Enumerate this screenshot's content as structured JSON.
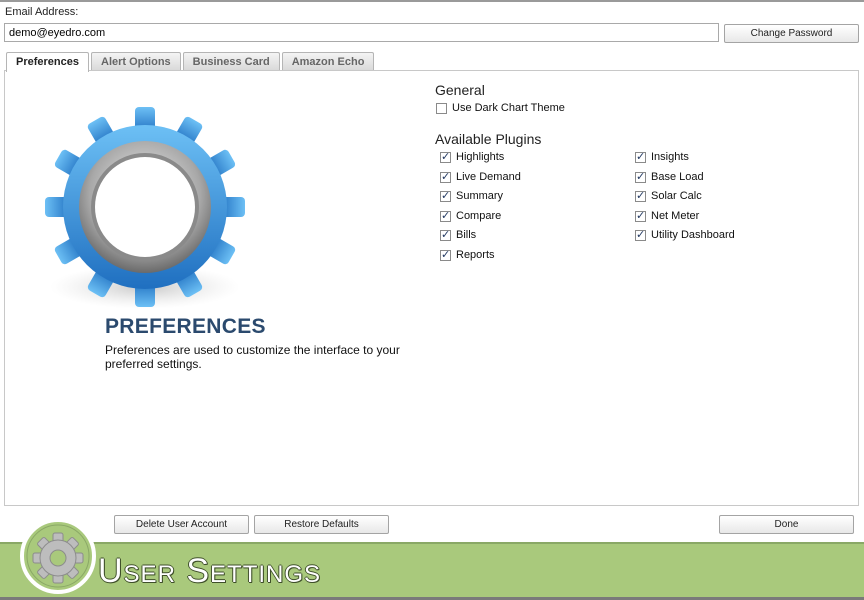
{
  "account": {
    "email_label": "Email Address:",
    "email_value": "demo@eyedro.com",
    "change_password_label": "Change Password"
  },
  "tabs": [
    {
      "label": "Preferences",
      "active": true
    },
    {
      "label": "Alert Options",
      "active": false
    },
    {
      "label": "Business Card",
      "active": false
    },
    {
      "label": "Amazon Echo",
      "active": false
    }
  ],
  "hero": {
    "title": "PREFERENCES",
    "description": "Preferences are used to customize the interface to your preferred settings."
  },
  "general": {
    "title": "General",
    "dark_chart_theme": {
      "label": "Use Dark Chart Theme",
      "checked": false
    }
  },
  "plugins": {
    "title": "Available Plugins",
    "left": [
      {
        "label": "Highlights",
        "checked": true
      },
      {
        "label": "Live Demand",
        "checked": true
      },
      {
        "label": "Summary",
        "checked": true
      },
      {
        "label": "Compare",
        "checked": true
      },
      {
        "label": "Bills",
        "checked": true
      },
      {
        "label": "Reports",
        "checked": true
      }
    ],
    "right": [
      {
        "label": "Insights",
        "checked": true
      },
      {
        "label": "Base Load",
        "checked": true
      },
      {
        "label": "Solar Calc",
        "checked": true
      },
      {
        "label": "Net Meter",
        "checked": true
      },
      {
        "label": "Utility Dashboard",
        "checked": true
      }
    ]
  },
  "actions": {
    "delete_account_label": "Delete User Account",
    "restore_defaults_label": "Restore Defaults",
    "done_label": "Done"
  },
  "footer": {
    "title": "User Settings"
  },
  "icons": {
    "hero": "gear-icon",
    "footer": "gear-icon"
  },
  "colors": {
    "footer_bg": "#a9c97c",
    "gear_blue": "#2f8fd8",
    "hero_title": "#2b4a6e"
  }
}
